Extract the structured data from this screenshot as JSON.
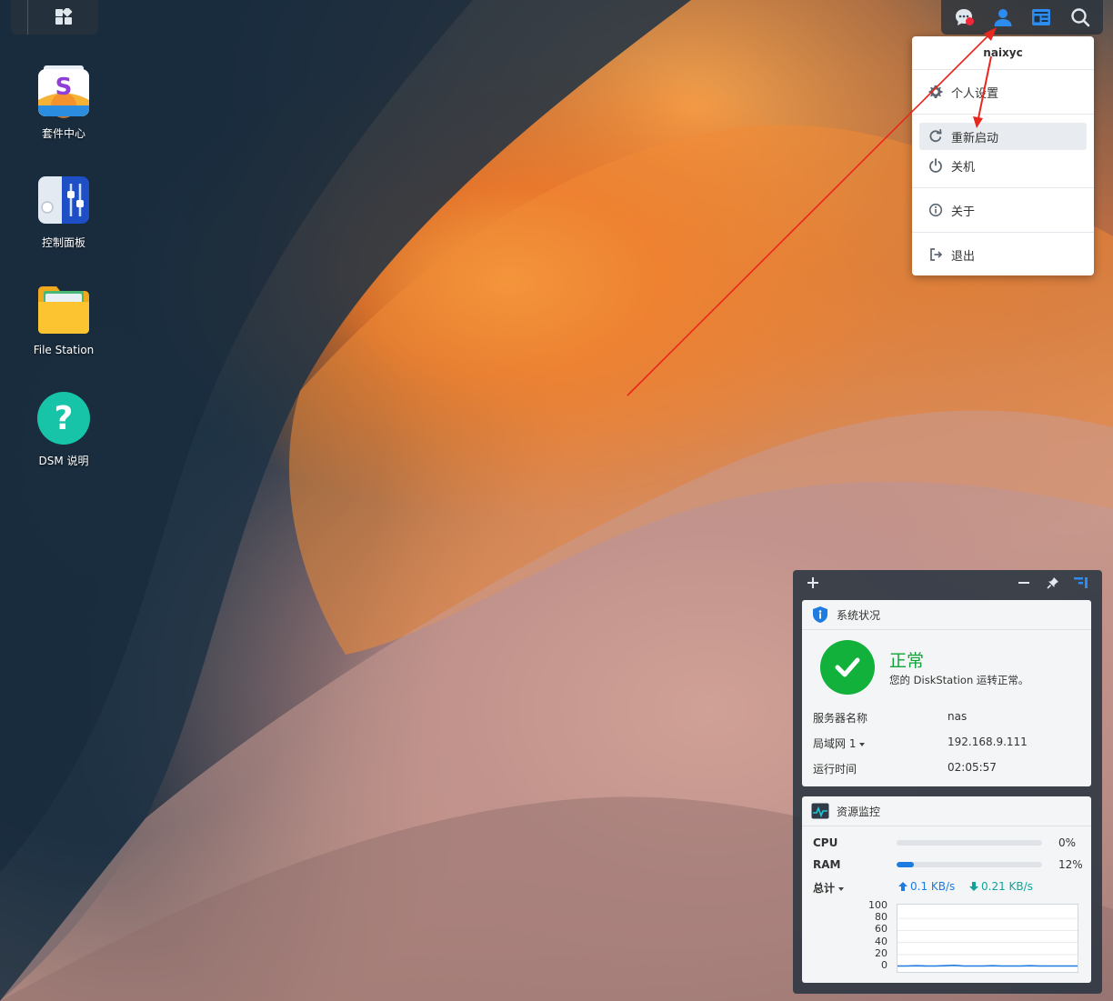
{
  "taskbar": {
    "left_icons": [
      "main-menu-icon"
    ],
    "right_icons": [
      "notifications-icon",
      "user-icon",
      "widgets-icon",
      "search-icon"
    ],
    "notification_dot_color": "#f2273a",
    "active_color": "#2d8cf0"
  },
  "desktop": {
    "icons": [
      {
        "label": "套件中心",
        "icon": "package-center-icon"
      },
      {
        "label": "控制面板",
        "icon": "control-panel-icon"
      },
      {
        "label": "File Station",
        "icon": "file-station-icon"
      },
      {
        "label": "DSM 说明",
        "icon": "dsm-help-icon"
      }
    ]
  },
  "user_menu": {
    "username": "naixyc",
    "items": [
      {
        "label": "个人设置",
        "icon": "gear-icon"
      },
      {
        "label": "重新启动",
        "icon": "restart-icon",
        "highlighted": true
      },
      {
        "label": "关机",
        "icon": "power-icon"
      },
      {
        "label": "关于",
        "icon": "info-icon"
      },
      {
        "label": "退出",
        "icon": "logout-icon"
      }
    ]
  },
  "widgets": {
    "toolbar": [
      "add-icon",
      "minimize-icon",
      "pin-icon",
      "widget-layout-icon"
    ],
    "system_status": {
      "title": "系统状况",
      "status": "正常",
      "description": "您的 DiskStation 运转正常。",
      "rows": [
        {
          "key": "服务器名称",
          "value": "nas"
        },
        {
          "key": "局域网 1",
          "value": "192.168.9.111",
          "has_dropdown": true
        },
        {
          "key": "运行时间",
          "value": "02:05:57"
        }
      ],
      "status_color": "#11b13b"
    },
    "resource_monitor": {
      "title": "资源监控",
      "cpu_label": "CPU",
      "cpu_percent": 0,
      "cpu_text": "0%",
      "ram_label": "RAM",
      "ram_percent": 12,
      "ram_text": "12%",
      "total_label": "总计",
      "upload": "0.1 KB/s",
      "download": "0.21 KB/s",
      "upload_color": "#1e7be0",
      "download_color": "#11a39b"
    }
  },
  "chart_data": {
    "type": "line",
    "ylim": [
      0,
      100
    ],
    "yticks": [
      "100",
      "80",
      "60",
      "40",
      "20",
      "0"
    ],
    "series": [
      {
        "values": [
          1,
          1,
          1.5,
          1,
          1,
          1.5,
          2,
          1,
          1,
          1,
          1.5,
          1,
          1,
          1,
          1.5,
          1,
          1,
          1,
          1,
          1
        ]
      }
    ]
  },
  "annotations": {
    "arrow_color": "#e8271f"
  }
}
